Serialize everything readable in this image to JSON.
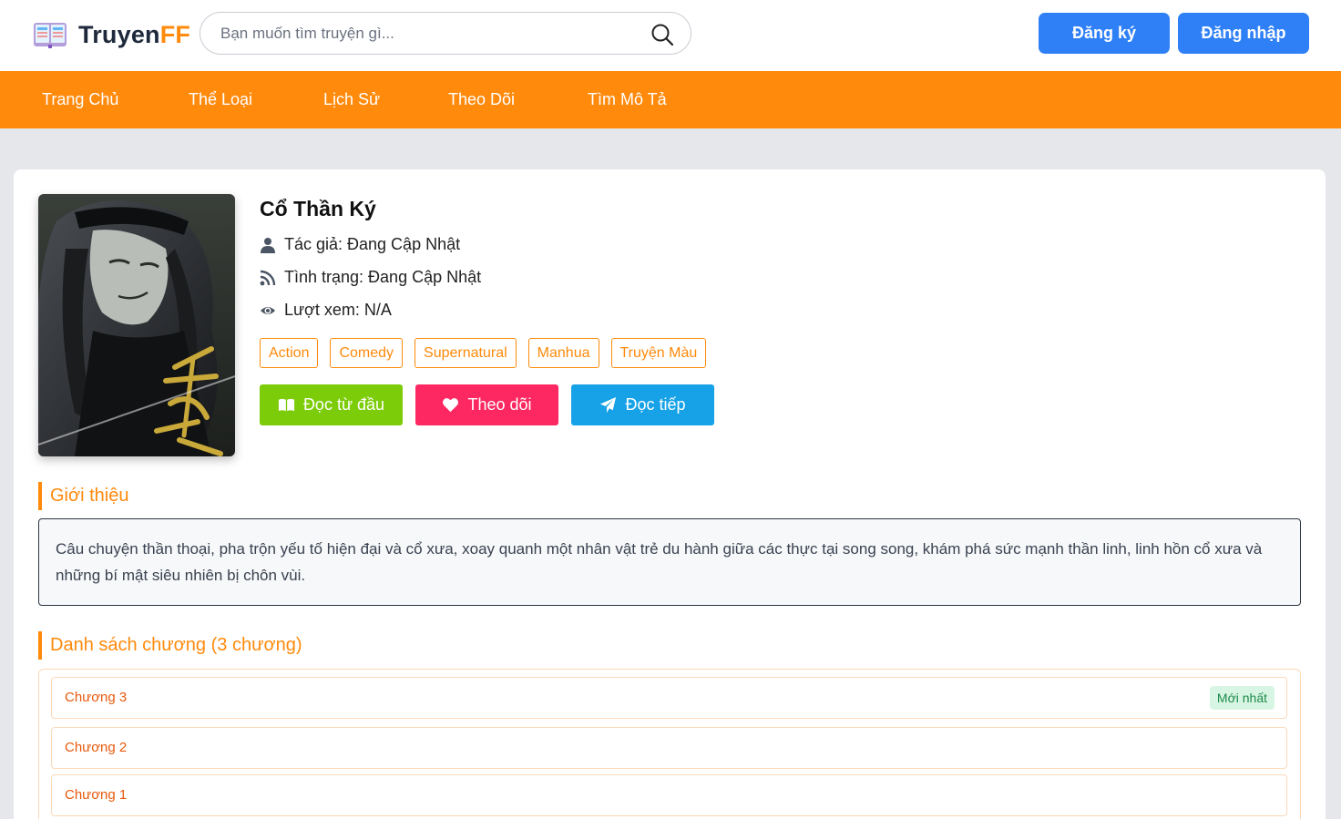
{
  "header": {
    "logo_text": "Truyen",
    "logo_accent": "FF",
    "search_placeholder": "Bạn muốn tìm truyện gì...",
    "signup_label": "Đăng ký",
    "login_label": "Đăng nhập"
  },
  "nav": {
    "items": [
      {
        "label": "Trang Chủ"
      },
      {
        "label": "Thể Loại"
      },
      {
        "label": "Lịch Sử"
      },
      {
        "label": "Theo Dõi"
      },
      {
        "label": "Tìm Mô Tả"
      }
    ]
  },
  "story": {
    "title": "Cổ Thần Ký",
    "author": "Tác giả: Đang Cập Nhật",
    "status": "Tình trạng: Đang Cập Nhật",
    "views": "Lượt xem: N/A",
    "tags": [
      "Action",
      "Comedy",
      "Supernatural",
      "Manhua",
      "Truyện Màu"
    ],
    "actions": {
      "read_from_start": "Đọc từ đầu",
      "follow": "Theo dõi",
      "continue": "Đọc tiếp"
    }
  },
  "intro": {
    "heading": "Giới thiệu",
    "text": "Câu chuyện thần thoại, pha trộn yếu tố hiện đại và cổ xưa, xoay quanh một nhân vật trẻ du hành giữa các thực tại song song, khám phá sức mạnh thần linh, linh hồn cổ xưa và những bí mật siêu nhiên bị chôn vùi."
  },
  "chapters": {
    "heading": "Danh sách chương (3 chương)",
    "latest_badge": "Mới nhất",
    "items": [
      {
        "label": "Chương 3"
      },
      {
        "label": "Chương 2"
      },
      {
        "label": "Chương 1"
      }
    ]
  },
  "colors": {
    "accent": "#ff8a0c",
    "primary_button": "#2f80f6",
    "read_button": "#7dcc0a",
    "follow_button": "#fd2861",
    "continue_button": "#17a2e8"
  }
}
